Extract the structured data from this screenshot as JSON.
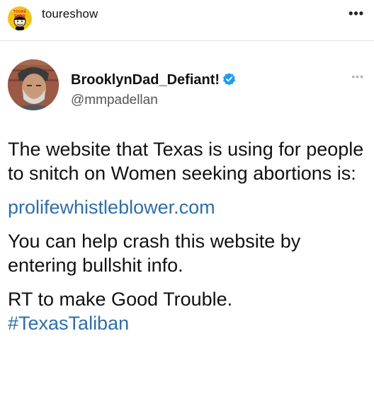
{
  "instagram_header": {
    "username": "toureshow",
    "avatar_brand": "TOURÉ SHOW",
    "more_label": "•••"
  },
  "tweet": {
    "display_name": "BrooklynDad_Defiant!",
    "handle": "@mmpadellan",
    "more_label": "•••",
    "paragraph_1": "The website that Texas is using for people to snitch on Women seeking abortions is:",
    "link": "prolifewhistleblower.com",
    "paragraph_2": "You can help crash this website by entering bullshit info.",
    "paragraph_3": "RT to make Good Trouble.",
    "hashtag": "#TexasTaliban"
  },
  "colors": {
    "link_blue": "#2f6ea8",
    "verified_blue": "#1d9bf0",
    "avatar_yellow": "#f2c418"
  }
}
